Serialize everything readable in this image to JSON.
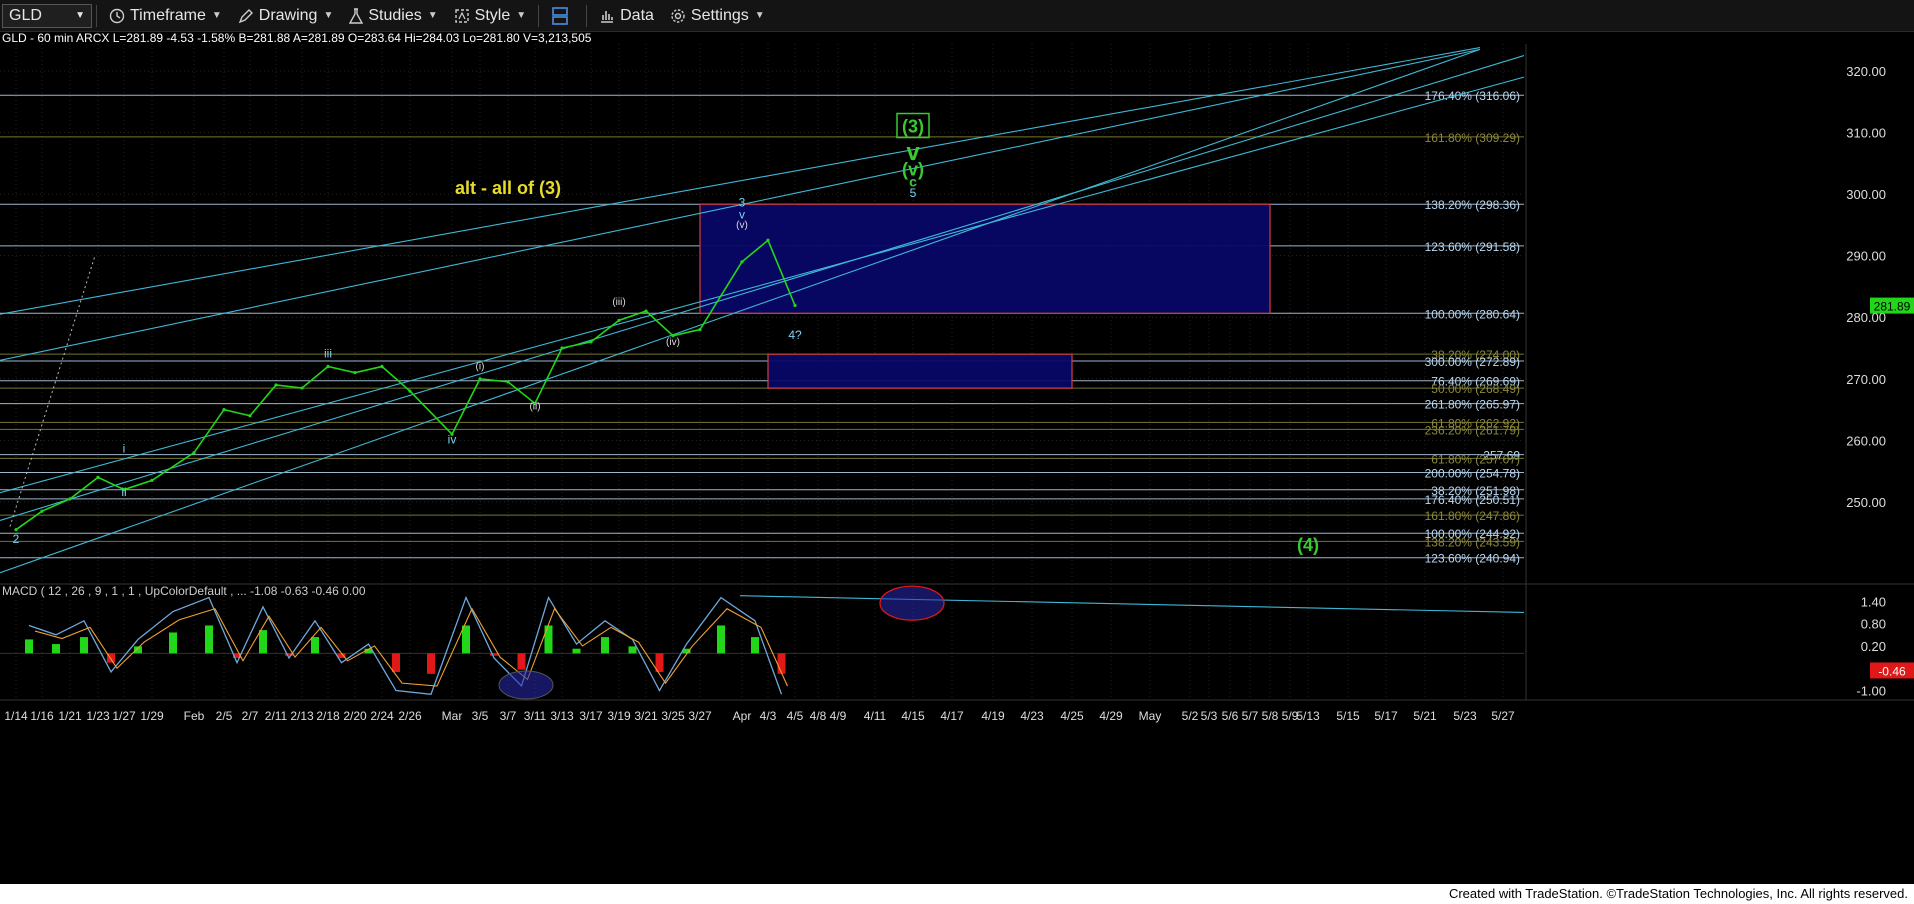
{
  "toolbar": {
    "symbol": "GLD",
    "timeframe": "Timeframe",
    "drawing": "Drawing",
    "studies": "Studies",
    "style": "Style",
    "data": "Data",
    "settings": "Settings"
  },
  "info_line": "GLD - 60 min  ARCX  L=281.89  -4.53  -1.58%  B=281.88  A=281.89  O=283.64  Hi=284.03  Lo=281.80  V=3,213,505",
  "macd_header": "MACD ( 12 , 26 , 9 , 1 , 1 , UpColorDefault , ...   -1.08   -0.63   -0.46   0.00",
  "last_price": "281.89",
  "macd_last": "-0.46",
  "footer": "Created with TradeStation. ©TradeStation Technologies, Inc. All rights reserved.",
  "colors": {
    "up": "#22d61a",
    "down": "#e01818",
    "fib": "#b9d7f0",
    "channel": "#3fb8d6",
    "box_fill": "#080868",
    "box_border": "#d43a3a",
    "yellow": "#e8dc2a",
    "green_label": "#39c930"
  },
  "chart_data": {
    "type": "line",
    "title": "GLD - 60 min",
    "price_axis": {
      "min": 237,
      "max": 326,
      "ticks": [
        250,
        260,
        270,
        280,
        290,
        300,
        310,
        320
      ]
    },
    "date_labels": [
      "1/14",
      "1/16",
      "1/21",
      "1/23",
      "1/27",
      "1/29",
      "Feb",
      "2/5",
      "2/7",
      "2/11",
      "2/13",
      "2/18",
      "2/20",
      "2/24",
      "2/26",
      "Mar",
      "3/5",
      "3/7",
      "3/11",
      "3/13",
      "3/17",
      "3/19",
      "3/21",
      "3/25",
      "3/27",
      "Apr",
      "4/3",
      "4/5",
      "4/8",
      "4/9",
      "4/11",
      "4/15",
      "4/17",
      "4/19",
      "4/23",
      "4/25",
      "4/29",
      "May",
      "5/2",
      "5/3",
      "5/6",
      "5/7",
      "5/8",
      "5/9",
      "5/13",
      "5/15",
      "5/17",
      "5/21",
      "5/23",
      "5/27"
    ],
    "price_path": [
      {
        "d": "1/14",
        "v": 245.5
      },
      {
        "d": "1/16",
        "v": 248.5
      },
      {
        "d": "1/21",
        "v": 250.5
      },
      {
        "d": "1/23",
        "v": 254
      },
      {
        "d": "1/27",
        "v": 252
      },
      {
        "d": "1/29",
        "v": 253.5
      },
      {
        "d": "Feb",
        "v": 258
      },
      {
        "d": "2/5",
        "v": 265
      },
      {
        "d": "2/7",
        "v": 264
      },
      {
        "d": "2/11",
        "v": 269
      },
      {
        "d": "2/13",
        "v": 268.5
      },
      {
        "d": "2/18",
        "v": 272
      },
      {
        "d": "2/20",
        "v": 271
      },
      {
        "d": "2/24",
        "v": 272
      },
      {
        "d": "2/26",
        "v": 268
      },
      {
        "d": "Mar",
        "v": 261
      },
      {
        "d": "3/5",
        "v": 270
      },
      {
        "d": "3/7",
        "v": 269.5
      },
      {
        "d": "3/11",
        "v": 266
      },
      {
        "d": "3/13",
        "v": 275
      },
      {
        "d": "3/17",
        "v": 276
      },
      {
        "d": "3/19",
        "v": 279.5
      },
      {
        "d": "3/21",
        "v": 281
      },
      {
        "d": "3/25",
        "v": 277
      },
      {
        "d": "3/27",
        "v": 278
      },
      {
        "d": "Apr",
        "v": 289
      },
      {
        "d": "4/3",
        "v": 292.5
      },
      {
        "d": "4/5",
        "v": 281.9
      }
    ],
    "fib_levels": [
      {
        "label": "176.40% (316.06)",
        "v": 316.06
      },
      {
        "label": "161.80% (309.29)",
        "v": 309.29
      },
      {
        "label": "138.20% (298.36)",
        "v": 298.36
      },
      {
        "label": "123.60% (291.58)",
        "v": 291.58
      },
      {
        "label": "100.00% (280.64)",
        "v": 280.64
      },
      {
        "label": "38.20% (274.00)",
        "v": 274.0
      },
      {
        "label": "300.00% (272.89)",
        "v": 272.89
      },
      {
        "label": "76.40% (269.69)",
        "v": 269.69
      },
      {
        "label": "50.00% (268.49)",
        "v": 268.49
      },
      {
        "label": "261.80% (265.97)",
        "v": 265.97
      },
      {
        "label": "61.80% (262.92)",
        "v": 262.92
      },
      {
        "label": "236.20% (261.79)",
        "v": 261.79
      },
      {
        "label": "257.69",
        "v": 257.69
      },
      {
        "label": "61.80% (257.07)",
        "v": 257.07
      },
      {
        "label": "200.00% (254.78)",
        "v": 254.78
      },
      {
        "label": "38.20% (251.98)",
        "v": 251.98
      },
      {
        "label": "176.40% (250.51)",
        "v": 250.51
      },
      {
        "label": "161.80% (247.86)",
        "v": 247.86
      },
      {
        "label": "100.00% (244.92)",
        "v": 244.92
      },
      {
        "label": "138.20% (243.59)",
        "v": 243.59
      },
      {
        "label": "123.60% (240.94)",
        "v": 240.94
      }
    ],
    "boxes": [
      {
        "name": "target-zone-upper",
        "from": "3/27",
        "to": "5/8",
        "top": 298.36,
        "bottom": 280.64
      },
      {
        "name": "target-zone-lower",
        "from": "4/3",
        "to": "4/25",
        "top": 274.0,
        "bottom": 268.49
      }
    ],
    "wave_labels": [
      {
        "text": "2",
        "d": "1/14",
        "v": 243.3
      },
      {
        "text": "i",
        "d": "1/27",
        "v": 258
      },
      {
        "text": "ii",
        "d": "1/27",
        "v": 251
      },
      {
        "text": "iii",
        "d": "2/18",
        "v": 273.5
      },
      {
        "text": "iv",
        "d": "Mar",
        "v": 259.5
      },
      {
        "text": "(i)",
        "d": "3/5",
        "v": 271.5
      },
      {
        "text": "(ii)",
        "d": "3/11",
        "v": 265
      },
      {
        "text": "(iii)",
        "d": "3/19",
        "v": 282
      },
      {
        "text": "(iv)",
        "d": "3/25",
        "v": 275.5
      },
      {
        "text": "3",
        "d": "Apr",
        "v": 298
      },
      {
        "text": "v",
        "d": "Apr",
        "v": 296
      },
      {
        "text": "(v)",
        "d": "Apr",
        "v": 294.5
      },
      {
        "text": "4?",
        "d": "4/5",
        "v": 276.5
      },
      {
        "text": "5",
        "d": "4/15",
        "v": 299.5
      },
      {
        "text": "alt  - all of (3)",
        "d": "3/7",
        "v": 300
      },
      {
        "text": "(3)",
        "d": "4/15",
        "v": 310
      },
      {
        "text": "v",
        "d": "4/15",
        "v": 305.5
      },
      {
        "text": "(v)",
        "d": "4/15",
        "v": 303
      },
      {
        "text": "c",
        "d": "4/15",
        "v": 301.2
      },
      {
        "text": "(4)",
        "d": "5/13",
        "v": 242
      }
    ],
    "macd": {
      "axis_ticks": [
        1.4,
        0.8,
        0.2,
        -0.46,
        -1.0
      ],
      "min": -1.2,
      "max": 1.65,
      "last": -0.46
    }
  }
}
